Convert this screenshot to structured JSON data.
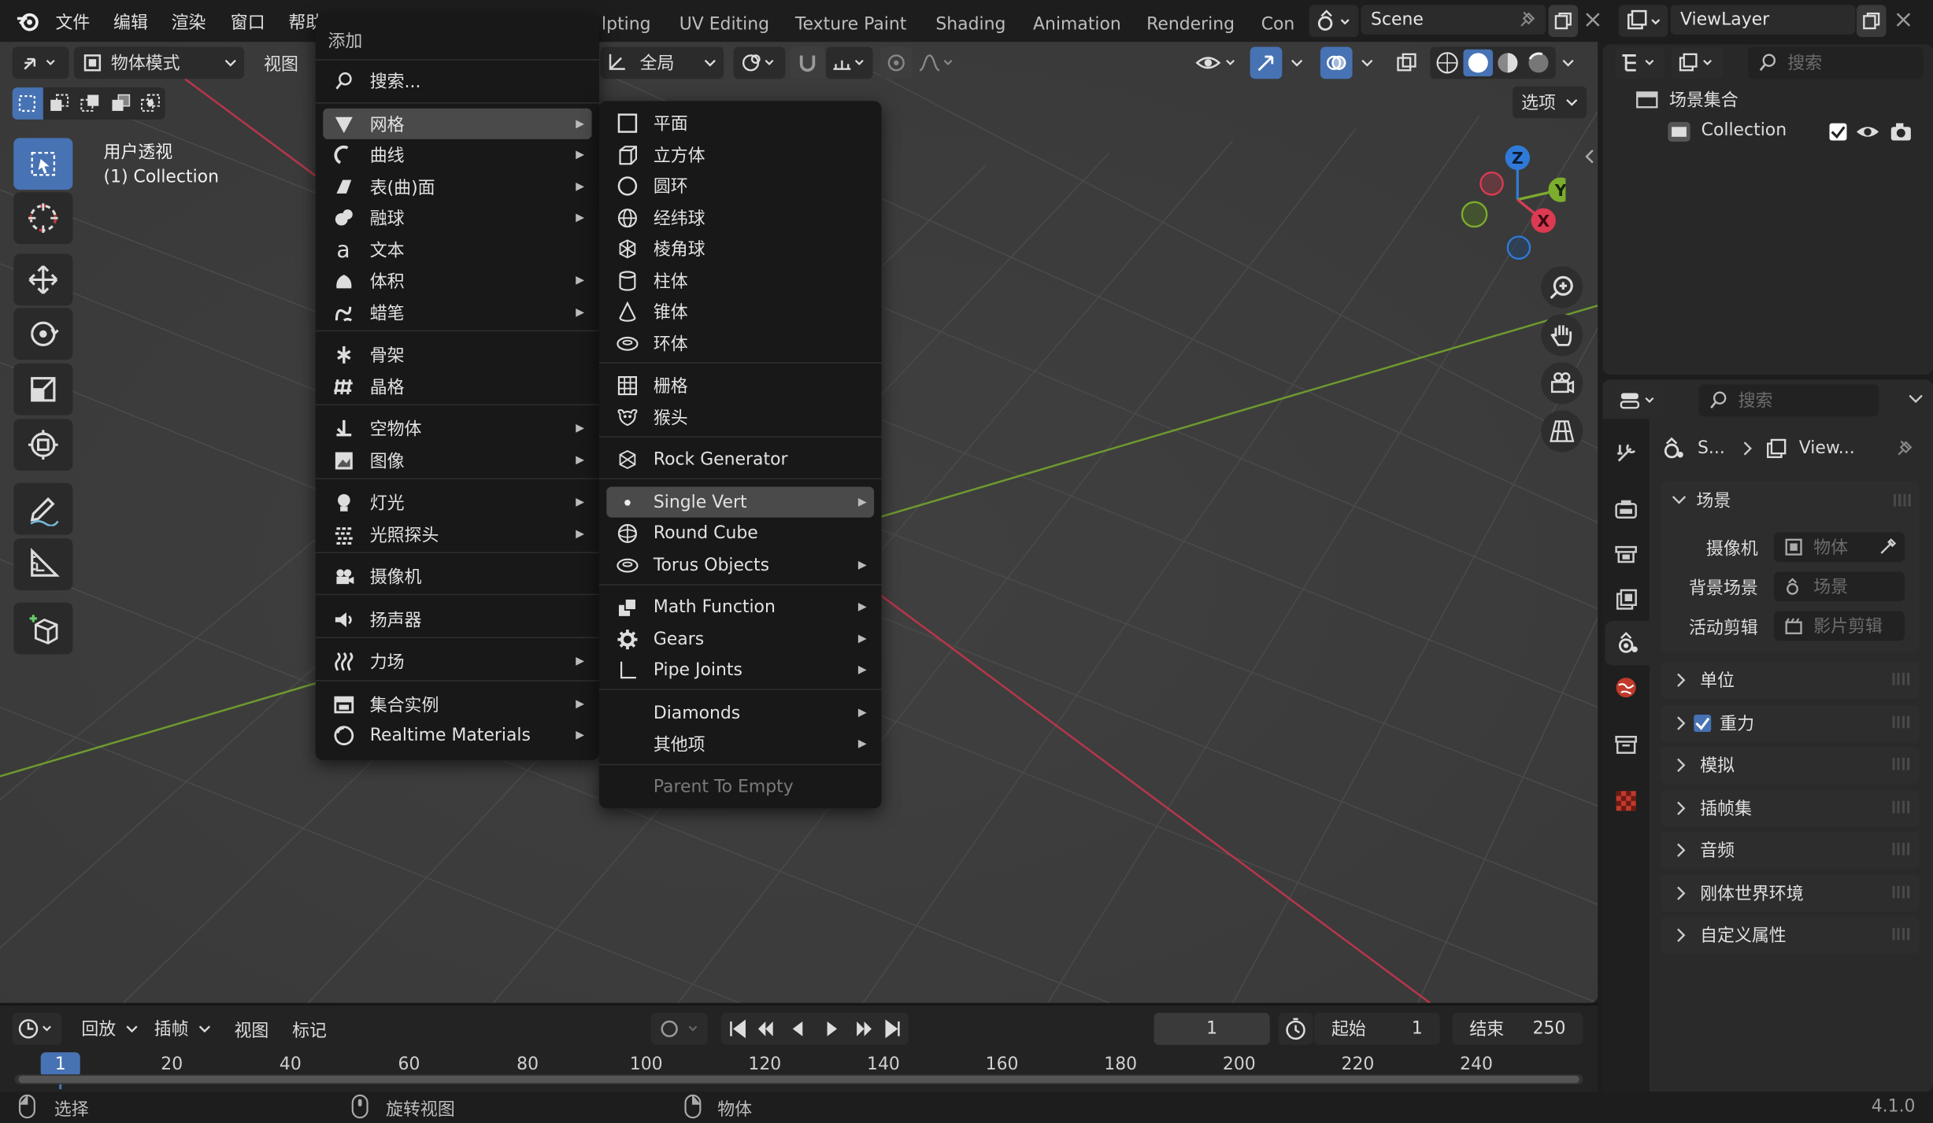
{
  "app": {
    "version": "4.1.0"
  },
  "topbar": {
    "menus": [
      "文件",
      "编辑",
      "渲染",
      "窗口",
      "帮助"
    ],
    "workspace_tabs": [
      "lpting",
      "UV Editing",
      "Texture Paint",
      "Shading",
      "Animation",
      "Rendering",
      "Con"
    ],
    "scene": "Scene",
    "view_layer": "ViewLayer"
  },
  "viewport": {
    "mode": "物体模式",
    "view_menu": "视图",
    "transform_orientation": "全局",
    "options_label": "选项",
    "overlay_title": "用户透视",
    "overlay_collection": "(1) Collection",
    "gizmo_axes": {
      "z": "Z",
      "y": "Y",
      "x": "X"
    }
  },
  "add_menu": {
    "title": "添加",
    "search": "搜索...",
    "items": [
      {
        "label": "网格",
        "submenu": true
      },
      {
        "label": "曲线",
        "submenu": true
      },
      {
        "label": "表(曲)面",
        "submenu": true
      },
      {
        "label": "融球",
        "submenu": true
      },
      {
        "label": "文本",
        "submenu": false
      },
      {
        "label": "体积",
        "submenu": true
      },
      {
        "label": "蜡笔",
        "submenu": true
      },
      {
        "label": "骨架",
        "submenu": false
      },
      {
        "label": "晶格",
        "submenu": false
      },
      {
        "label": "空物体",
        "submenu": true
      },
      {
        "label": "图像",
        "submenu": true
      },
      {
        "label": "灯光",
        "submenu": true
      },
      {
        "label": "光照探头",
        "submenu": true
      },
      {
        "label": "摄像机",
        "submenu": false
      },
      {
        "label": "扬声器",
        "submenu": false
      },
      {
        "label": "力场",
        "submenu": true
      },
      {
        "label": "集合实例",
        "submenu": true
      },
      {
        "label": "Realtime Materials",
        "submenu": true
      }
    ]
  },
  "mesh_menu": {
    "items": [
      {
        "label": "平面",
        "icon": "plane-icon"
      },
      {
        "label": "立方体",
        "icon": "cube-icon"
      },
      {
        "label": "圆环",
        "icon": "circle-icon"
      },
      {
        "label": "经纬球",
        "icon": "uv-sphere-icon"
      },
      {
        "label": "棱角球",
        "icon": "ico-sphere-icon"
      },
      {
        "label": "柱体",
        "icon": "cylinder-icon"
      },
      {
        "label": "锥体",
        "icon": "cone-icon"
      },
      {
        "label": "环体",
        "icon": "torus-icon"
      },
      {
        "label": "栅格",
        "icon": "grid-icon"
      },
      {
        "label": "猴头",
        "icon": "monkey-icon"
      },
      {
        "label": "Rock Generator",
        "icon": "rock-icon"
      },
      {
        "label": "Single Vert",
        "icon": "dot-icon"
      },
      {
        "label": "Round Cube",
        "icon": "sphere-icon"
      },
      {
        "label": "Torus Objects",
        "icon": "torus-icon"
      },
      {
        "label": "Math Function",
        "icon": "math-icon"
      },
      {
        "label": "Gears",
        "icon": "gear-icon"
      },
      {
        "label": "Pipe Joints",
        "icon": "pipe-icon"
      },
      {
        "label": "Diamonds",
        "icon": ""
      },
      {
        "label": "其他项",
        "icon": ""
      },
      {
        "label": "Parent To Empty",
        "icon": ""
      }
    ]
  },
  "outliner": {
    "search_placeholder": "搜索",
    "scene_collection": "场景集合",
    "collection": "Collection"
  },
  "properties": {
    "search_placeholder": "搜索",
    "breadcrumb_scene": "S...",
    "breadcrumb_view": "View...",
    "scene_section": "场景",
    "camera_label": "摄像机",
    "camera_placeholder": "物体",
    "background_label": "背景场景",
    "background_placeholder": "场景",
    "clip_label": "活动剪辑",
    "clip_placeholder": "影片剪辑",
    "sections": [
      "单位",
      "重力",
      "模拟",
      "插帧集",
      "音频",
      "刚体世界环境",
      "自定义属性"
    ],
    "gravity_checked": true
  },
  "timeline": {
    "playback": "回放",
    "keying": "插帧",
    "view": "视图",
    "marker": "标记",
    "current_frame": "1",
    "start_label": "起始",
    "start_value": "1",
    "end_label": "结束",
    "end_value": "250",
    "ticks": [
      "20",
      "40",
      "60",
      "80",
      "100",
      "120",
      "140",
      "160",
      "180",
      "200",
      "220",
      "240"
    ],
    "playhead": "1"
  },
  "statusbar": {
    "select": "选择",
    "rotate_view": "旋转视图",
    "object": "物体"
  }
}
